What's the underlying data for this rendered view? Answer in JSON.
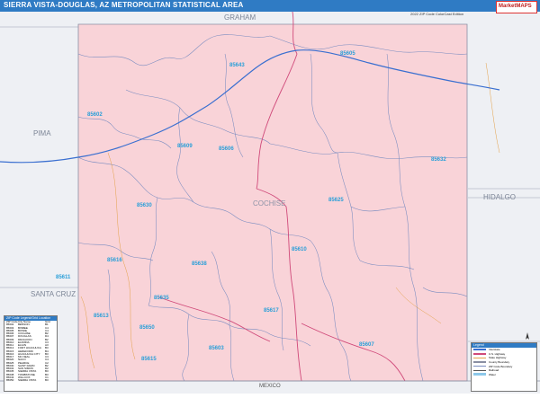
{
  "title": "SIERRA VISTA-DOUGLAS, AZ METROPOLITAN STATISTICAL AREA",
  "edition": "2022 ZIP Code ColorCast Edition",
  "publisher_logo": "MarketMAPS",
  "colors": {
    "title_bar": "#2f7bc4",
    "county_fill": "#f9d3d8",
    "outside_fill": "#eef0f4",
    "zip_label": "#2a9fd8",
    "zip_boundary": "#6f86b8",
    "interstate": "#3a6fd0",
    "highway": "#d04a7a",
    "county_line": "#8a8fa3"
  },
  "region_labels": {
    "graham": "GRAHAM",
    "pima": "PIMA",
    "cochise": "COCHISE",
    "hidalgo": "HIDALGO",
    "santa_cruz": "SANTA CRUZ",
    "mexico": "MEXICO"
  },
  "zip_codes": [
    "85605",
    "85643",
    "85602",
    "85609",
    "85606",
    "85632",
    "85630",
    "85625",
    "85610",
    "85616",
    "85638",
    "85611",
    "85635",
    "85613",
    "85617",
    "85650",
    "85603",
    "85607",
    "85615"
  ],
  "legend": {
    "header": "ZIP Code Legend/Grid Location",
    "columns": [
      "ZIP Code",
      "City Name",
      "Grid"
    ],
    "rows": [
      [
        "85602",
        "BENSON",
        "B1"
      ],
      [
        "85603",
        "BISBEE",
        "C4"
      ],
      [
        "85605",
        "BOWIE",
        "C4"
      ],
      [
        "85606",
        "COCHISE",
        "B2"
      ],
      [
        "85607",
        "DOUGLAS",
        "D4"
      ],
      [
        "85609",
        "DRAGOON",
        "B2"
      ],
      [
        "85610",
        "ELFRIDA",
        "C3"
      ],
      [
        "85611",
        "ELGIN",
        "A3"
      ],
      [
        "85613",
        "FORT HUACHUCA",
        "B3"
      ],
      [
        "85615",
        "HEREFORD",
        "B4"
      ],
      [
        "85616",
        "HUACHUCA CITY",
        "B3"
      ],
      [
        "85617",
        "MC NEAL",
        "C3"
      ],
      [
        "85620",
        "NACO",
        "C4"
      ],
      [
        "85625",
        "PEARCE",
        "C2"
      ],
      [
        "85630",
        "SAINT DAVID",
        "B2"
      ],
      [
        "85632",
        "SAN SIMON",
        "D2"
      ],
      [
        "85635",
        "SIERRA VISTA",
        "B3"
      ],
      [
        "85638",
        "TOMBSTONE",
        "B3"
      ],
      [
        "85643",
        "WILLCOX",
        "C1"
      ],
      [
        "85650",
        "SIERRA VISTA",
        "B3"
      ]
    ]
  },
  "map_key": {
    "header": "Legend",
    "items": [
      "Interstate",
      "U.S. Highway",
      "State Highway",
      "County Boundary",
      "ZIP Code Boundary",
      "Railroad",
      "Water"
    ]
  },
  "compass_label": "N"
}
